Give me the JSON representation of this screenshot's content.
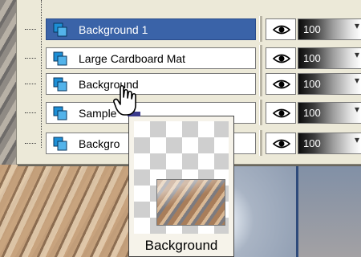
{
  "layers": [
    {
      "name": "Background 1",
      "selected": true,
      "opacity": "100"
    },
    {
      "name": "Large Cardboard Mat",
      "selected": false,
      "opacity": "100"
    },
    {
      "name": "Background",
      "selected": false,
      "opacity": "100"
    },
    {
      "name": "Sample",
      "selected": false,
      "opacity": "100"
    },
    {
      "name": "Backgro",
      "selected": false,
      "opacity": "100"
    }
  ],
  "preview": {
    "caption": "Background"
  },
  "colors": {
    "selection": "#3a63a8",
    "panel": "#ece9d8",
    "layer_icon": "#1d8fd6"
  }
}
